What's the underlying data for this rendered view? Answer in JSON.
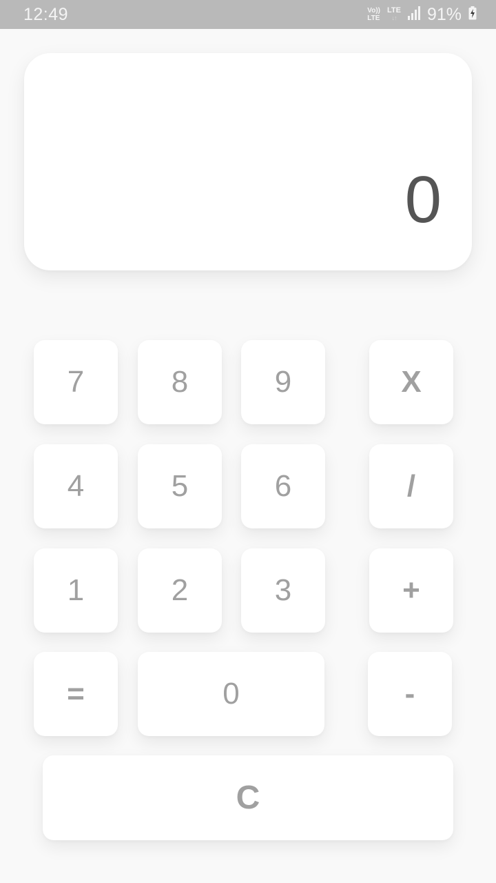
{
  "status_bar": {
    "time": "12:49",
    "volte_top": "Vo))",
    "volte_bottom": "LTE",
    "lte": "LTE",
    "battery_percent": "91%",
    "signal_icon": "signal-icon",
    "battery_icon": "battery-charging-icon"
  },
  "display": {
    "value": "0"
  },
  "keypad": {
    "seven": "7",
    "eight": "8",
    "nine": "9",
    "multiply": "X",
    "four": "4",
    "five": "5",
    "six": "6",
    "divide": "/",
    "one": "1",
    "two": "2",
    "three": "3",
    "plus": "+",
    "equals": "=",
    "zero": "0",
    "minus": "-",
    "clear": "C"
  },
  "colors": {
    "background": "#f9f9f9",
    "status_bar": "#b9b9b9",
    "key_surface": "#ffffff",
    "key_text": "#a0a0a0",
    "display_text": "#555555"
  }
}
